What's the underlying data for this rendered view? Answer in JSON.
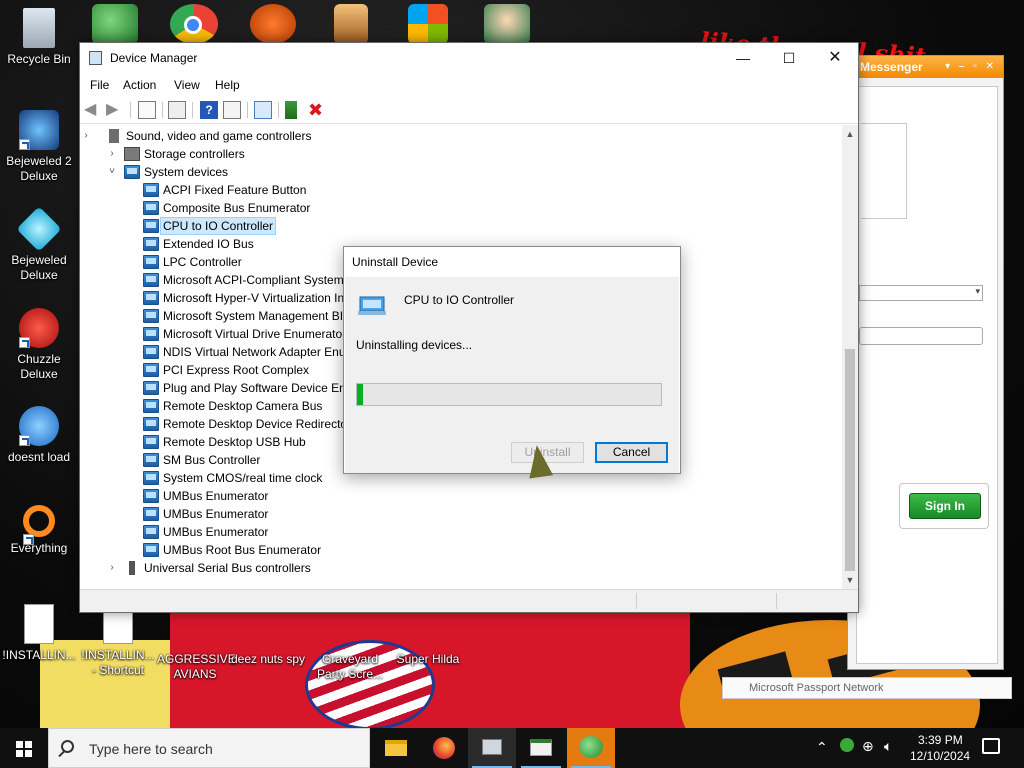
{
  "desktop": {
    "icons": [
      {
        "label": "Recycle Bin"
      },
      {
        "label": "Bejeweled 2 Deluxe"
      },
      {
        "label": "Bejeweled Deluxe"
      },
      {
        "label": "Chuzzle Deluxe"
      },
      {
        "label": "doesnt load"
      },
      {
        "label": "Everything"
      },
      {
        "label": "!INSTALLIN..."
      },
      {
        "label": "!INSTALLIN... - Shortcut"
      },
      {
        "label": "AGGRESSIVE AVIANS"
      },
      {
        "label": "deez nuts spy"
      },
      {
        "label": "Graveyard Party Scre..."
      },
      {
        "label": "Super Hilda"
      }
    ],
    "wallpaper_text": "like the cool shit"
  },
  "messenger": {
    "title": "Messenger",
    "signin_label": "Sign In",
    "footer": "Microsoft Passport Network"
  },
  "device_manager": {
    "title": "Device Manager",
    "menu": [
      "File",
      "Action",
      "View",
      "Help"
    ],
    "tree": [
      {
        "label": "Sound, video and game controllers",
        "level": 0,
        "expanded": false
      },
      {
        "label": "Storage controllers",
        "level": 0,
        "expanded": false
      },
      {
        "label": "System devices",
        "level": 0,
        "expanded": true
      },
      {
        "label": "ACPI Fixed Feature Button",
        "level": 1
      },
      {
        "label": "Composite Bus Enumerator",
        "level": 1
      },
      {
        "label": "CPU to IO Controller",
        "level": 1,
        "selected": true
      },
      {
        "label": "Extended IO Bus",
        "level": 1
      },
      {
        "label": "LPC Controller",
        "level": 1
      },
      {
        "label": "Microsoft ACPI-Compliant System",
        "level": 1
      },
      {
        "label": "Microsoft Hyper-V Virtualization In",
        "level": 1
      },
      {
        "label": "Microsoft System Management BIO",
        "level": 1
      },
      {
        "label": "Microsoft Virtual Drive Enumerator",
        "level": 1
      },
      {
        "label": "NDIS Virtual Network Adapter Enum",
        "level": 1
      },
      {
        "label": "PCI Express Root Complex",
        "level": 1
      },
      {
        "label": "Plug and Play Software Device Enu",
        "level": 1
      },
      {
        "label": "Remote Desktop Camera Bus",
        "level": 1
      },
      {
        "label": "Remote Desktop Device Redirector",
        "level": 1
      },
      {
        "label": "Remote Desktop USB Hub",
        "level": 1
      },
      {
        "label": "SM Bus Controller",
        "level": 1
      },
      {
        "label": "System CMOS/real time clock",
        "level": 1
      },
      {
        "label": "UMBus Enumerator",
        "level": 1
      },
      {
        "label": "UMBus Enumerator",
        "level": 1
      },
      {
        "label": "UMBus Enumerator",
        "level": 1
      },
      {
        "label": "UMBus Root Bus Enumerator",
        "level": 1
      },
      {
        "label": "Universal Serial Bus controllers",
        "level": 0,
        "expanded": false
      }
    ]
  },
  "uninstall_dialog": {
    "title": "Uninstall Device",
    "device_name": "CPU to IO Controller",
    "status": "Uninstalling devices...",
    "progress_fraction": 0.02,
    "uninstall_label": "Uninstall",
    "cancel_label": "Cancel"
  },
  "taskbar": {
    "search_placeholder": "Type here to search",
    "time": "3:39 PM",
    "date": "12/10/2024"
  },
  "colors": {
    "progress_fill": "#06b025",
    "selection": "#cce8ff",
    "taskbar": "#101010"
  }
}
